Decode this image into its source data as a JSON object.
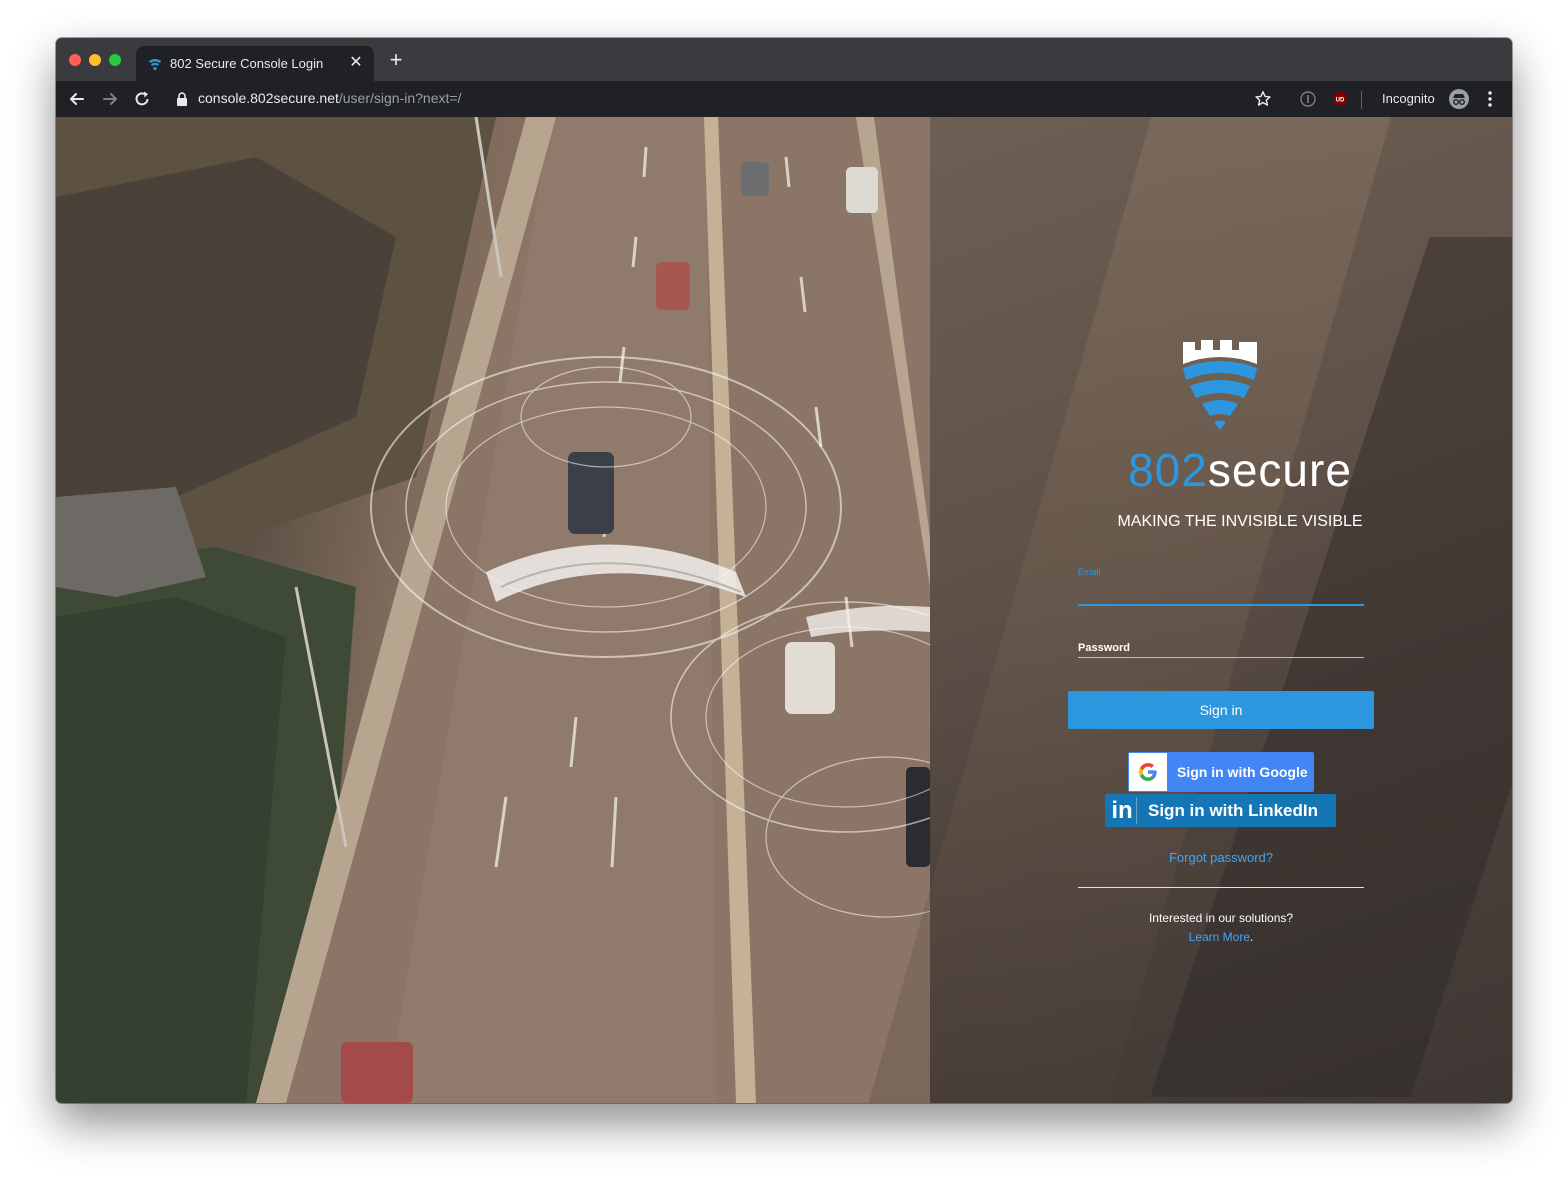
{
  "browser": {
    "tab_title": "802 Secure Console Login",
    "tab_close": "✕",
    "new_tab": "+",
    "url_host": "console.802secure.net",
    "url_path": "/user/sign-in?next=/",
    "incognito_label": "Incognito",
    "extension_badge": "UD"
  },
  "brand": {
    "number": "802",
    "word": "secure",
    "tagline": "MAKING THE INVISIBLE VISIBLE",
    "primary_color": "#2c97de"
  },
  "login": {
    "email_label": "Email",
    "password_label": "Password",
    "signin_label": "Sign in",
    "google_label": "Sign in with Google",
    "linkedin_icon": "in",
    "linkedin_label": "Sign in with LinkedIn",
    "forgot_label": "Forgot password?"
  },
  "footer": {
    "interested": "Interested in our solutions?",
    "learn_more": "Learn More",
    "learn_more_suffix": "."
  }
}
